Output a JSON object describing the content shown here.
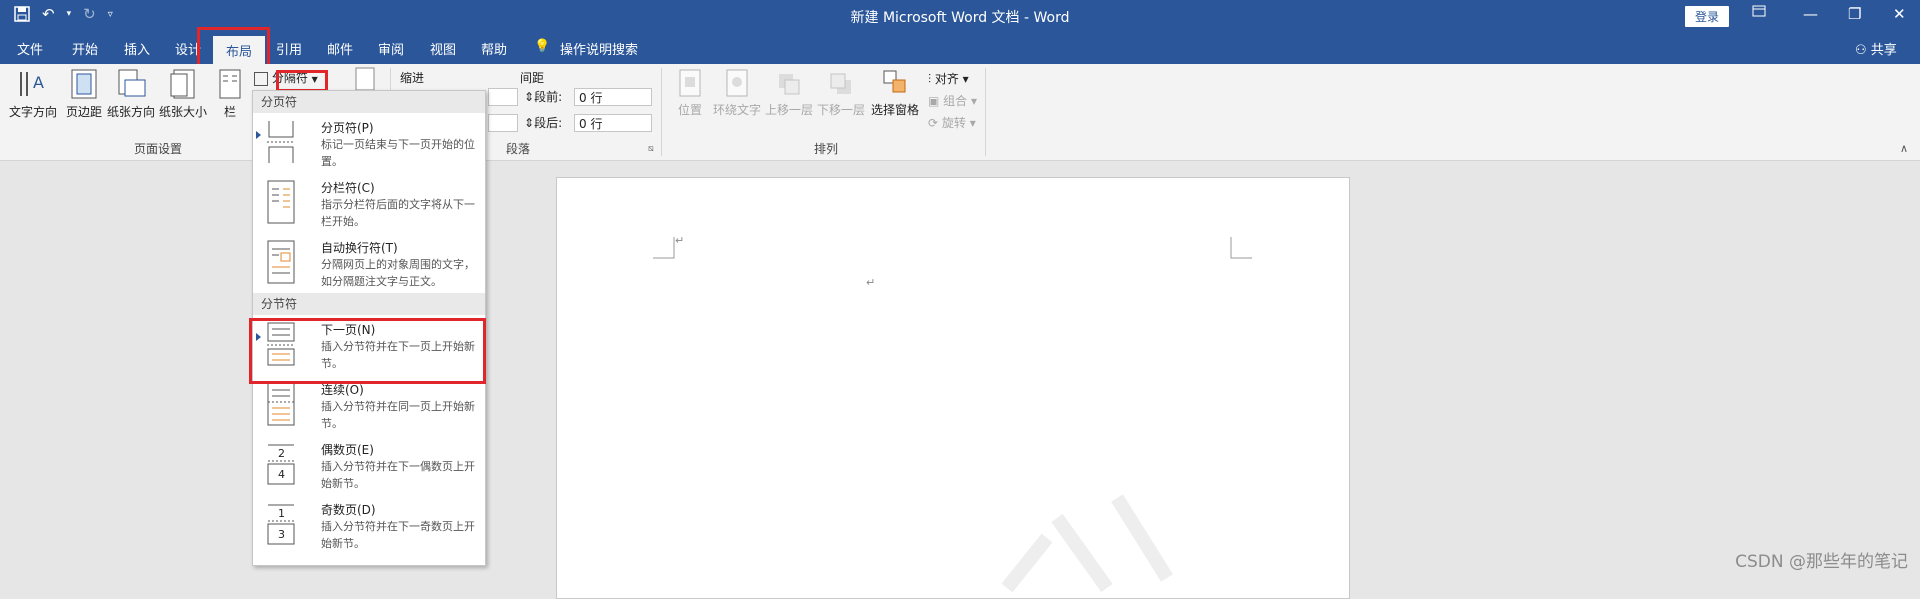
{
  "window": {
    "title": "新建 Microsoft Word 文档 - Word",
    "login_label": "登录",
    "share_label": "共享"
  },
  "tabs": [
    "文件",
    "开始",
    "插入",
    "设计",
    "布局",
    "引用",
    "邮件",
    "审阅",
    "视图",
    "帮助"
  ],
  "active_tab": "布局",
  "tell_me": "操作说明搜索",
  "ribbon": {
    "page_setup": {
      "group_label": "页面设置",
      "buttons": [
        "文字方向",
        "页边距",
        "纸张方向",
        "纸张大小",
        "栏"
      ],
      "breaks_button": "分隔符"
    },
    "paragraph": {
      "group_label": "段落",
      "indent_label": "缩进",
      "spacing_label": "间距",
      "before_label": "段前:",
      "before_value": "0 行",
      "after_label": "段后:",
      "after_value": "0 行"
    },
    "arrange": {
      "group_label": "排列",
      "buttons": [
        "位置",
        "环绕文字",
        "上移一层",
        "下移一层",
        "选择窗格"
      ],
      "align": "对齐",
      "group": "组合",
      "rotate": "旋转"
    }
  },
  "breaks_menu": {
    "page_breaks_header": "分页符",
    "section_breaks_header": "分节符",
    "items": [
      {
        "title": "分页符(P)",
        "desc": "标记一页结束与下一页开始的位置。",
        "icon": "page-break-icon"
      },
      {
        "title": "分栏符(C)",
        "desc": "指示分栏符后面的文字将从下一栏开始。",
        "icon": "column-break-icon"
      },
      {
        "title": "自动换行符(T)",
        "desc": "分隔网页上的对象周围的文字，如分隔题注文字与正文。",
        "icon": "text-wrapping-break-icon"
      },
      {
        "title": "下一页(N)",
        "desc": "插入分节符并在下一页上开始新节。",
        "icon": "next-page-section-icon"
      },
      {
        "title": "连续(O)",
        "desc": "插入分节符并在同一页上开始新节。",
        "icon": "continuous-section-icon"
      },
      {
        "title": "偶数页(E)",
        "desc": "插入分节符并在下一偶数页上开始新节。",
        "icon": "even-page-section-icon"
      },
      {
        "title": "奇数页(D)",
        "desc": "插入分节符并在下一奇数页上开始新节。",
        "icon": "odd-page-section-icon"
      }
    ]
  },
  "document": {
    "paragraph_mark": "↵"
  },
  "watermark": "CSDN @那些年的笔记",
  "colors": {
    "word_blue": "#2b579a",
    "highlight_red": "#e0262a",
    "ribbon_bg": "#f3f3f3"
  }
}
